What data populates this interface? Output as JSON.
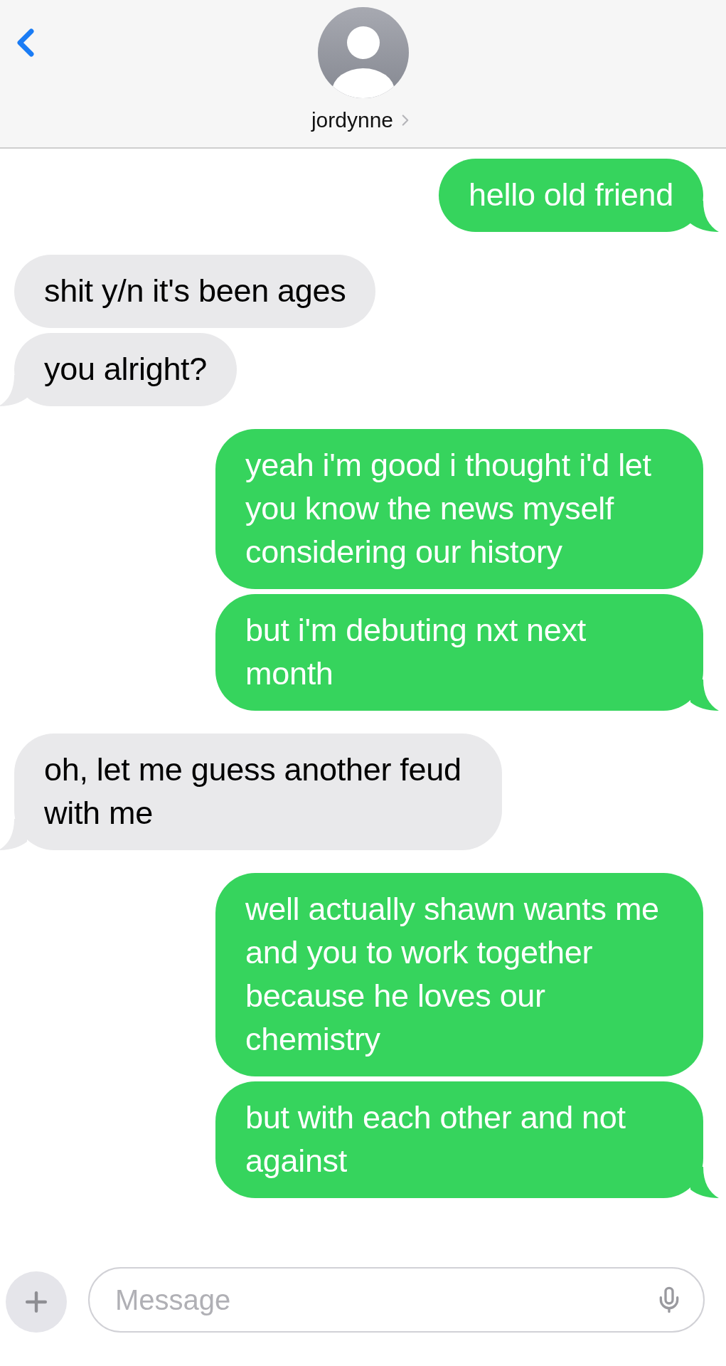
{
  "contact": {
    "name": "jordynne"
  },
  "messages": [
    {
      "kind": "sent",
      "text": "hello old friend"
    },
    {
      "kind": "received",
      "text": "shit y/n it's been ages"
    },
    {
      "kind": "received",
      "text": "you alright?"
    },
    {
      "kind": "sent",
      "text": "yeah i'm good i thought i'd let you know the news myself considering our history"
    },
    {
      "kind": "sent",
      "text": "but i'm debuting nxt next month"
    },
    {
      "kind": "received",
      "text": "oh, let me guess another feud with me"
    },
    {
      "kind": "sent",
      "text": "well actually shawn wants me and you to work together because he loves our chemistry"
    },
    {
      "kind": "sent",
      "text": "but with each other and not against"
    }
  ],
  "composer": {
    "placeholder": "Message"
  }
}
